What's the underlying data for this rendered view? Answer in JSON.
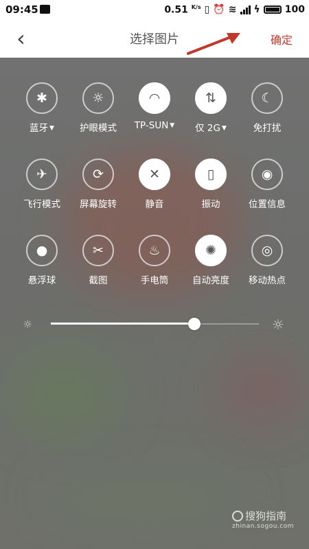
{
  "status": {
    "time": "09:45",
    "speed": "0.51",
    "speed_unit": "K/s",
    "battery": "100"
  },
  "header": {
    "back_icon": "‹",
    "title": "选择图片",
    "confirm": "确定"
  },
  "tiles": [
    {
      "label": "蓝牙",
      "icon": "bluetooth-icon",
      "glyph": "✱",
      "on": false,
      "caret": true
    },
    {
      "label": "护眼模式",
      "icon": "eye-care-icon",
      "glyph": "☼",
      "on": false,
      "caret": false
    },
    {
      "label": "TP-SUN",
      "icon": "wifi-icon",
      "glyph": "◠",
      "on": true,
      "caret": true
    },
    {
      "label": "仅 2G",
      "icon": "mobile-data-icon",
      "glyph": "⇅",
      "on": true,
      "caret": true
    },
    {
      "label": "免打扰",
      "icon": "moon-icon",
      "glyph": "☾",
      "on": false,
      "caret": false
    },
    {
      "label": "飞行模式",
      "icon": "airplane-icon",
      "glyph": "✈",
      "on": false,
      "caret": false
    },
    {
      "label": "屏幕旋转",
      "icon": "rotate-icon",
      "glyph": "⟳",
      "on": false,
      "caret": false
    },
    {
      "label": "静音",
      "icon": "mute-icon",
      "glyph": "✕",
      "on": true,
      "caret": false
    },
    {
      "label": "振动",
      "icon": "vibrate-icon",
      "glyph": "▯",
      "on": true,
      "caret": false
    },
    {
      "label": "位置信息",
      "icon": "location-icon",
      "glyph": "◉",
      "on": false,
      "caret": false
    },
    {
      "label": "悬浮球",
      "icon": "floating-ball-icon",
      "glyph": "●",
      "on": false,
      "caret": false
    },
    {
      "label": "截图",
      "icon": "scissors-icon",
      "glyph": "✂",
      "on": false,
      "caret": false
    },
    {
      "label": "手电筒",
      "icon": "flashlight-icon",
      "glyph": "♨",
      "on": false,
      "caret": false
    },
    {
      "label": "自动亮度",
      "icon": "auto-brightness-icon",
      "glyph": "✺",
      "on": true,
      "caret": false
    },
    {
      "label": "移动热点",
      "icon": "hotspot-icon",
      "glyph": "◎",
      "on": false,
      "caret": false
    }
  ],
  "brightness": {
    "level": 0.69,
    "low_icon": "brightness-low-icon",
    "high_icon": "brightness-high-icon"
  },
  "watermark": {
    "name": "搜狗指南",
    "url": "zhinan.sogou.com"
  },
  "colors": {
    "confirm": "#c1392b",
    "arrow": "#c0392b"
  }
}
